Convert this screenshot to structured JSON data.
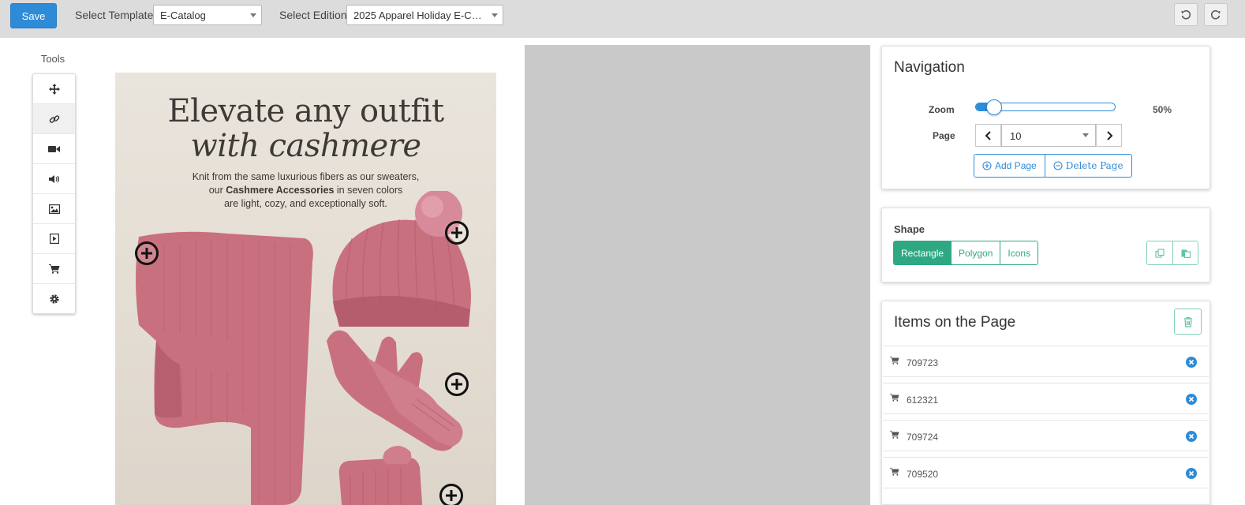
{
  "toolbar": {
    "save_label": "Save",
    "template_label": "Select Template",
    "template_value": "E-Catalog",
    "edition_label": "Select Edition",
    "edition_value": "2025 Apparel Holiday E-Ca...",
    "undo_icon": "undo-icon",
    "redo_icon": "redo-icon"
  },
  "tools": {
    "title": "Tools",
    "items": [
      "move-icon",
      "link-icon",
      "video-icon",
      "audio-icon",
      "image-icon",
      "slideshow-icon",
      "cart-icon",
      "gear-icon"
    ],
    "active_index": 1
  },
  "catalog": {
    "title_line1": "Elevate any outfit",
    "title_line2": "with cashmere",
    "body_line1": "Knit from the same luxurious fibers as our sweaters,",
    "body_line2_pre": "our ",
    "body_line2_bold": "Cashmere Accessories",
    "body_line2_post": " in seven colors",
    "body_line3": "are light, cozy, and exceptionally soft.",
    "accent_color": "#c9707f"
  },
  "navigation": {
    "title": "Navigation",
    "zoom_label": "Zoom",
    "zoom_value": "50%",
    "zoom_fraction": 0.13,
    "page_label": "Page",
    "page_value": "10",
    "add_page_label": "Add Page",
    "delete_page_label": "Delete  Page"
  },
  "shape": {
    "title": "Shape",
    "options": [
      "Rectangle",
      "Polygon",
      "Icons"
    ],
    "active": "Rectangle"
  },
  "items_panel": {
    "title": "Items on the Page",
    "items": [
      "709723",
      "612321",
      "709724",
      "709520"
    ]
  },
  "colors": {
    "primary": "#2e8bd8",
    "success": "#2ea883",
    "toolbar_bg": "#dcdcdc"
  }
}
